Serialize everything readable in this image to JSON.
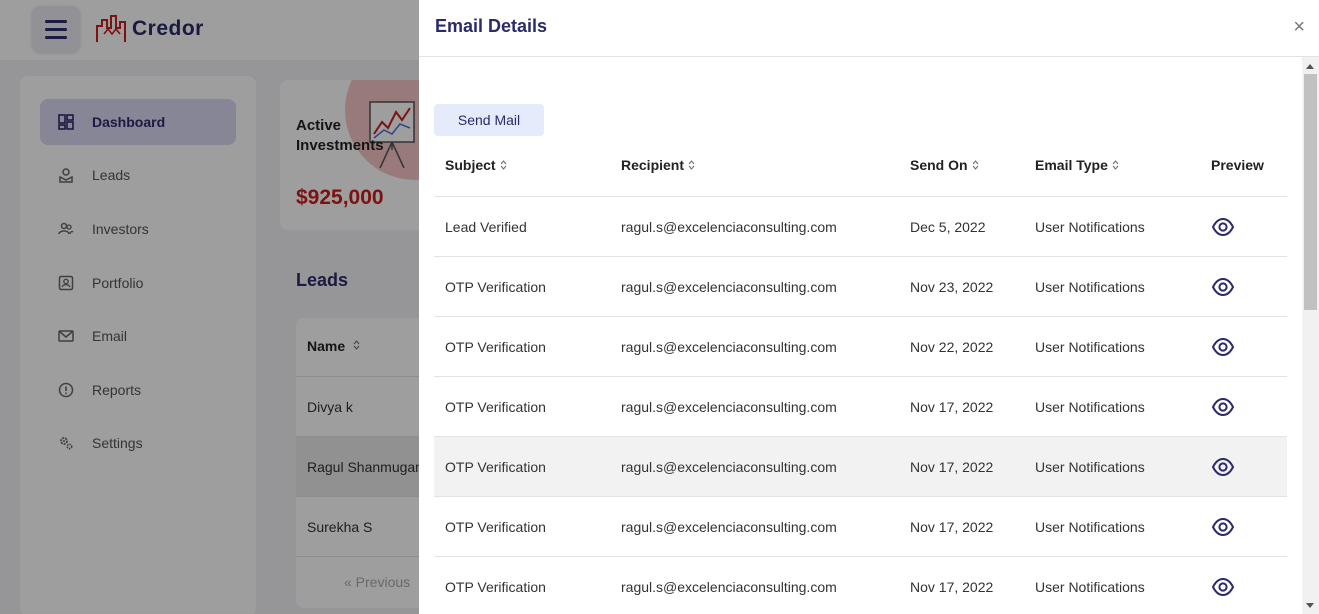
{
  "app": {
    "brand": "Credor",
    "sidebar": {
      "items": [
        {
          "label": "Dashboard",
          "icon": "dashboard-icon",
          "active": true
        },
        {
          "label": "Leads",
          "icon": "leads-icon"
        },
        {
          "label": "Investors",
          "icon": "investors-icon"
        },
        {
          "label": "Portfolio",
          "icon": "portfolio-icon"
        },
        {
          "label": "Email",
          "icon": "email-icon"
        },
        {
          "label": "Reports",
          "icon": "reports-icon"
        },
        {
          "label": "Settings",
          "icon": "settings-icon"
        }
      ]
    },
    "card": {
      "label": "Active Investments",
      "amount": "$925,000"
    },
    "leads": {
      "title": "Leads",
      "column": "Name",
      "rows": [
        "Divya k",
        "Ragul Shanmugam",
        "Surekha S"
      ],
      "pagination_prev": "« Previous"
    }
  },
  "drawer": {
    "title": "Email Details",
    "close": "×",
    "send_mail": "Send Mail",
    "columns": [
      "Subject",
      "Recipient",
      "Send On",
      "Email Type",
      "Preview"
    ],
    "rows": [
      {
        "subject": "Lead Verified",
        "recipient": "ragul.s@excelenciaconsulting.com",
        "sent_on": "Dec 5, 2022",
        "type": "User Notifications"
      },
      {
        "subject": "OTP Verification",
        "recipient": "ragul.s@excelenciaconsulting.com",
        "sent_on": "Nov 23, 2022",
        "type": "User Notifications"
      },
      {
        "subject": "OTP Verification",
        "recipient": "ragul.s@excelenciaconsulting.com",
        "sent_on": "Nov 22, 2022",
        "type": "User Notifications"
      },
      {
        "subject": "OTP Verification",
        "recipient": "ragul.s@excelenciaconsulting.com",
        "sent_on": "Nov 17, 2022",
        "type": "User Notifications"
      },
      {
        "subject": "OTP Verification",
        "recipient": "ragul.s@excelenciaconsulting.com",
        "sent_on": "Nov 17, 2022",
        "type": "User Notifications"
      },
      {
        "subject": "OTP Verification",
        "recipient": "ragul.s@excelenciaconsulting.com",
        "sent_on": "Nov 17, 2022",
        "type": "User Notifications"
      },
      {
        "subject": "OTP Verification",
        "recipient": "ragul.s@excelenciaconsulting.com",
        "sent_on": "Nov 17, 2022",
        "type": "User Notifications"
      }
    ]
  },
  "colors": {
    "brand_navy": "#2b2a6b",
    "amount_red": "#c81e1e",
    "active_nav_bg": "#d9d8f2",
    "send_mail_bg": "#e6ebfb"
  }
}
